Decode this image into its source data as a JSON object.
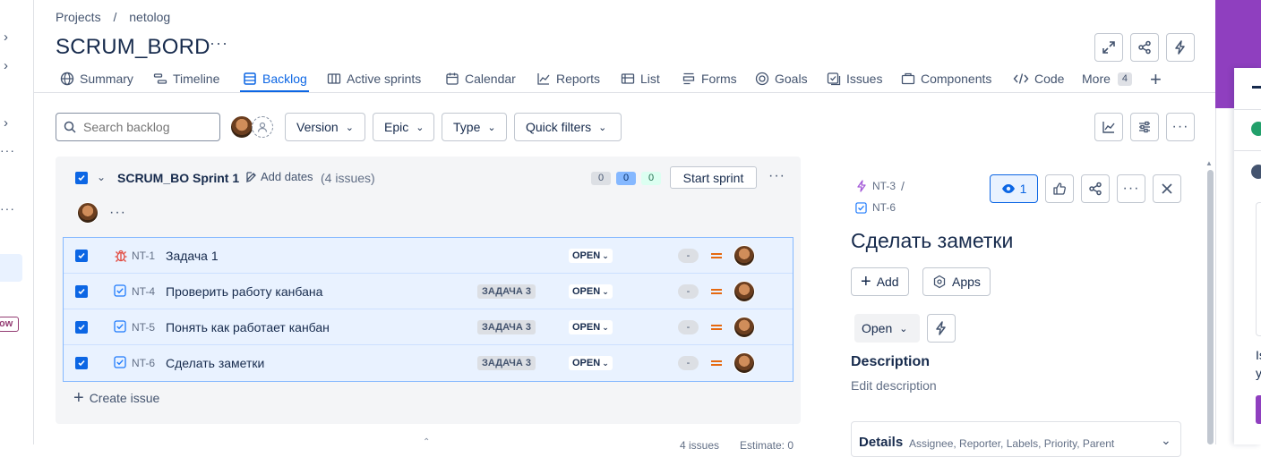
{
  "breadcrumb": {
    "projects": "Projects",
    "separator": "/",
    "project": "netolog"
  },
  "board_title": "SCRUM_BORD",
  "header_more": "···",
  "tabs": [
    {
      "label": "Summary",
      "icon": "globe-icon"
    },
    {
      "label": "Timeline",
      "icon": "timeline-icon"
    },
    {
      "label": "Backlog",
      "icon": "backlog-icon",
      "active": true
    },
    {
      "label": "Active sprints",
      "icon": "board-icon"
    },
    {
      "label": "Calendar",
      "icon": "calendar-icon"
    },
    {
      "label": "Reports",
      "icon": "chart-icon"
    },
    {
      "label": "List",
      "icon": "list-icon"
    },
    {
      "label": "Forms",
      "icon": "forms-icon"
    },
    {
      "label": "Goals",
      "icon": "goal-icon"
    },
    {
      "label": "Issues",
      "icon": "issues-icon"
    },
    {
      "label": "Components",
      "icon": "components-icon"
    },
    {
      "label": "Code",
      "icon": "code-icon"
    },
    {
      "label": "More",
      "badge": "4"
    }
  ],
  "toolbar": {
    "search_placeholder": "Search backlog",
    "version": "Version",
    "epic": "Epic",
    "type": "Type",
    "quick_filters": "Quick filters"
  },
  "sprint": {
    "name": "SCRUM_BO Sprint 1",
    "add_dates": "Add dates",
    "issue_count": "(4 issues)",
    "todo_count": "0",
    "in_progress_count": "0",
    "done_count": "0",
    "start_button": "Start sprint",
    "more": "···",
    "create_issue": "Create issue",
    "issues": [
      {
        "type": "bug",
        "key": "NT-1",
        "summary": "Задача 1",
        "parent": "",
        "status": "OPEN",
        "estimate": "-",
        "priority": "medium"
      },
      {
        "type": "task",
        "key": "NT-4",
        "summary": "Проверить работу канбана",
        "parent": "ЗАДАЧА 3",
        "status": "OPEN",
        "estimate": "-",
        "priority": "medium"
      },
      {
        "type": "task",
        "key": "NT-5",
        "summary": "Понять как работает канбан",
        "parent": "ЗАДАЧА 3",
        "status": "OPEN",
        "estimate": "-",
        "priority": "medium"
      },
      {
        "type": "task",
        "key": "NT-6",
        "summary": "Сделать заметки",
        "parent": "ЗАДАЧА 3",
        "status": "OPEN",
        "estimate": "-",
        "priority": "medium"
      }
    ]
  },
  "detail": {
    "parent_key": "NT-3",
    "separator": "/",
    "key": "NT-6",
    "watch_count": "1",
    "title": "Сделать заметки",
    "add": "Add",
    "apps": "Apps",
    "status": "Open",
    "description_heading": "Description",
    "description_placeholder": "Edit description",
    "details_heading": "Details",
    "details_sub": "Assignee, Reporter, Labels, Priority, Parent"
  },
  "footer": {
    "issues": "4 issues",
    "estimate": "Estimate: 0"
  },
  "left_rail": {
    "tag": "ow"
  },
  "right_panel": {
    "text1": "Is",
    "text2": "y"
  },
  "colors": {
    "accent": "#0c66e4",
    "purple": "#8f3fbf",
    "bug": "#e2483d",
    "priority": "#e56910"
  }
}
